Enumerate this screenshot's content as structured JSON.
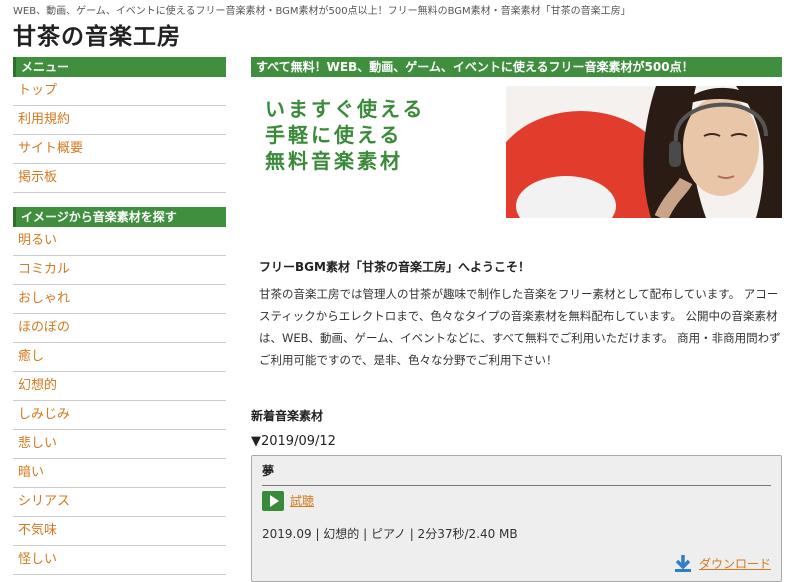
{
  "header": {
    "tagline": "WEB、動画、ゲーム、イベントに使えるフリー音楽素材・BGM素材が500点以上！フリー無料のBGM素材・音楽素材「甘茶の音楽工房」",
    "site_title": "甘茶の音楽工房"
  },
  "sidebar": {
    "menu_heading": "メニュー",
    "menu_items": [
      {
        "label": "トップ"
      },
      {
        "label": "利用規約"
      },
      {
        "label": "サイト概要"
      },
      {
        "label": "掲示板"
      }
    ],
    "mood_heading": "イメージから音楽素材を探す",
    "mood_items": [
      {
        "label": "明るい"
      },
      {
        "label": "コミカル"
      },
      {
        "label": "おしゃれ"
      },
      {
        "label": "ほのぼの"
      },
      {
        "label": "癒し"
      },
      {
        "label": "幻想的"
      },
      {
        "label": "しみじみ"
      },
      {
        "label": "悲しい"
      },
      {
        "label": "暗い"
      },
      {
        "label": "シリアス"
      },
      {
        "label": "不気味"
      },
      {
        "label": "怪しい"
      }
    ]
  },
  "main": {
    "heading": "すべて無料！WEB、動画、ゲーム、イベントに使えるフリー音楽素材が500点！",
    "banner_lines": [
      "いますぐ使える",
      "手軽に使える",
      "無料音楽素材"
    ],
    "welcome_title": "フリーBGM素材「甘茶の音楽工房」へようこそ！",
    "welcome_body": "甘茶の音楽工房では管理人の甘茶が趣味で制作した音楽をフリー素材として配布しています。 アコースティックからエレクトロまで、色々なタイプの音楽素材を無料配布しています。 公開中の音楽素材は、WEB、動画、ゲーム、イベントなどに、すべて無料でご利用いただけます。 商用・非商用問わずご利用可能ですので、是非、色々な分野でご利用下さい！",
    "new_section_title": "新着音楽素材",
    "new_date": "▼2019/09/12",
    "track": {
      "title": "夢",
      "listen_label": "試聴",
      "info": "2019.09 | 幻想的 | ピアノ | 2分37秒/2.40 MB",
      "download_label": "ダウンロード"
    }
  },
  "colors": {
    "accent_green": "#3f8f3f",
    "link_orange": "#d4791f",
    "download_blue": "#2d7fc7"
  }
}
